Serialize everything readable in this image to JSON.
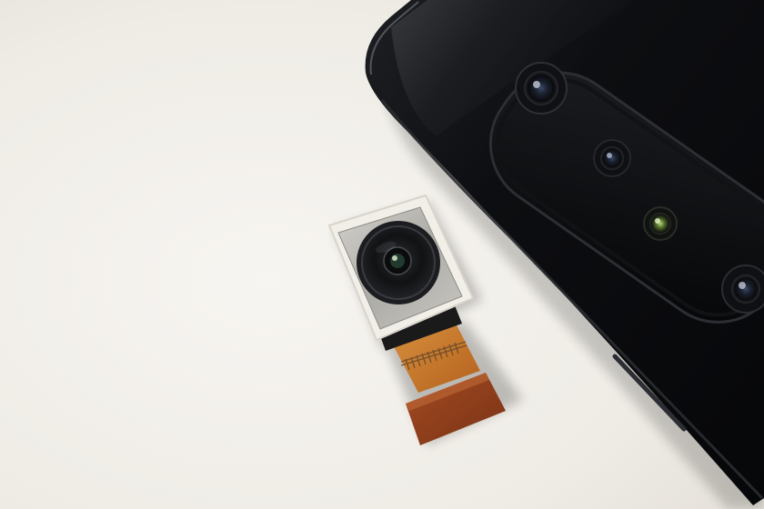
{
  "scene": {
    "background_color": "#f3f0eb",
    "phone_body_color": "#0b0c0e",
    "camera_bump_color": "#060708",
    "module_frame_color": "#f2efe8",
    "module_plate_color": "#b9b7b2",
    "lens_color": "#141517",
    "flex_cable_color": "#c8782a",
    "flex_connector_color": "#8e3f1e",
    "icons": [
      "smartphone-rear-camera-icon",
      "camera-module-icon",
      "flex-cable-icon"
    ]
  }
}
